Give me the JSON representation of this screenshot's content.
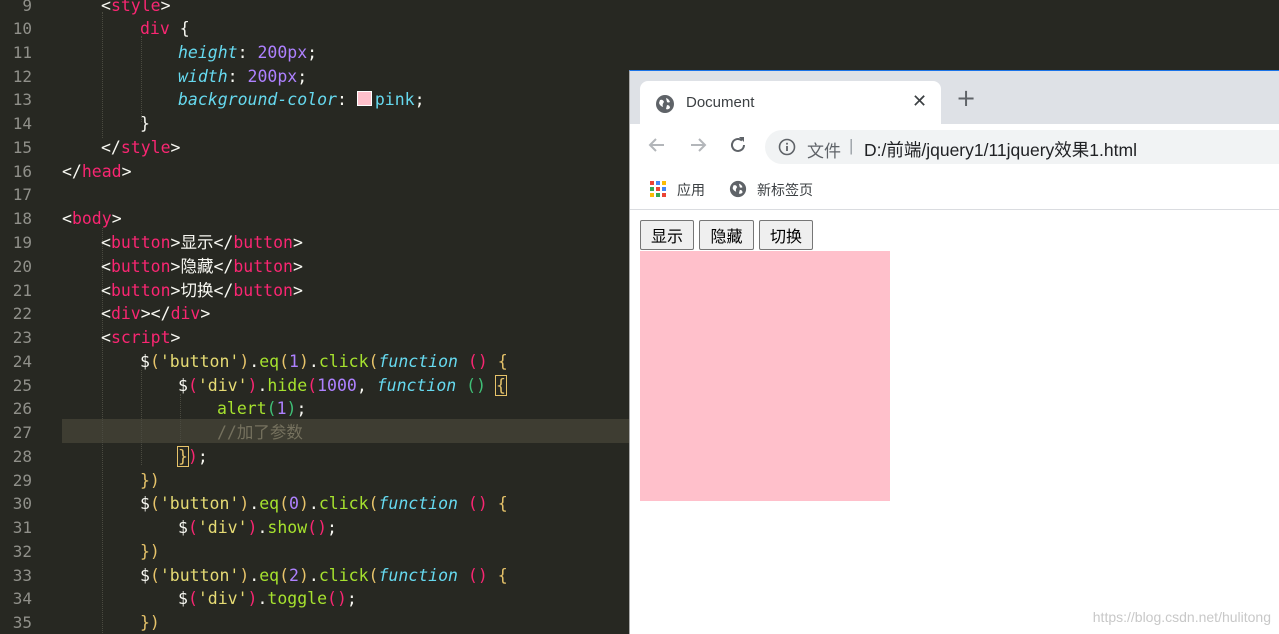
{
  "editor": {
    "line_numbers": [
      "9",
      "10",
      "11",
      "12",
      "13",
      "14",
      "15",
      "16",
      "17",
      "18",
      "19",
      "20",
      "21",
      "22",
      "23",
      "24",
      "25",
      "26",
      "27",
      "28",
      "29",
      "30",
      "31",
      "32",
      "33",
      "34",
      "35"
    ],
    "tokens": {
      "style": "style",
      "div": "div",
      "height": "height",
      "width": "width",
      "background_color": "background-color",
      "px200": "200px",
      "pink": "pink",
      "head": "head",
      "body": "body",
      "button": "button",
      "script": "script",
      "btn_show": "显示",
      "btn_hide": "隐藏",
      "btn_toggle": "切换",
      "q_button": "'button'",
      "q_div": "'div'",
      "eq": "eq",
      "click": "click",
      "hide": "hide",
      "show": "show",
      "toggle": "toggle",
      "alert": "alert",
      "function": "function",
      "n0": "0",
      "n1": "1",
      "n2": "2",
      "n1000": "1000",
      "comment": "//加了参数"
    }
  },
  "browser": {
    "tab_title": "Document",
    "tab_close": "✕",
    "new_tab": "+",
    "omnibox_label": "文件",
    "omnibox_sep": "|",
    "url": "D:/前端/jquery1/11jquery效果1.html",
    "bookmarks": [
      "应用",
      "新标签页"
    ],
    "page_buttons": [
      "显示",
      "隐藏",
      "切换"
    ],
    "box_color": "#ffc0cb"
  },
  "watermark": "https://blog.csdn.net/hulitong",
  "colors": {
    "editor_bg": "#272822",
    "tag": "#f92672",
    "property": "#66d9ef",
    "number": "#ae81ff",
    "string": "#e6db74",
    "function": "#a6e22e",
    "comment": "#75715e"
  }
}
